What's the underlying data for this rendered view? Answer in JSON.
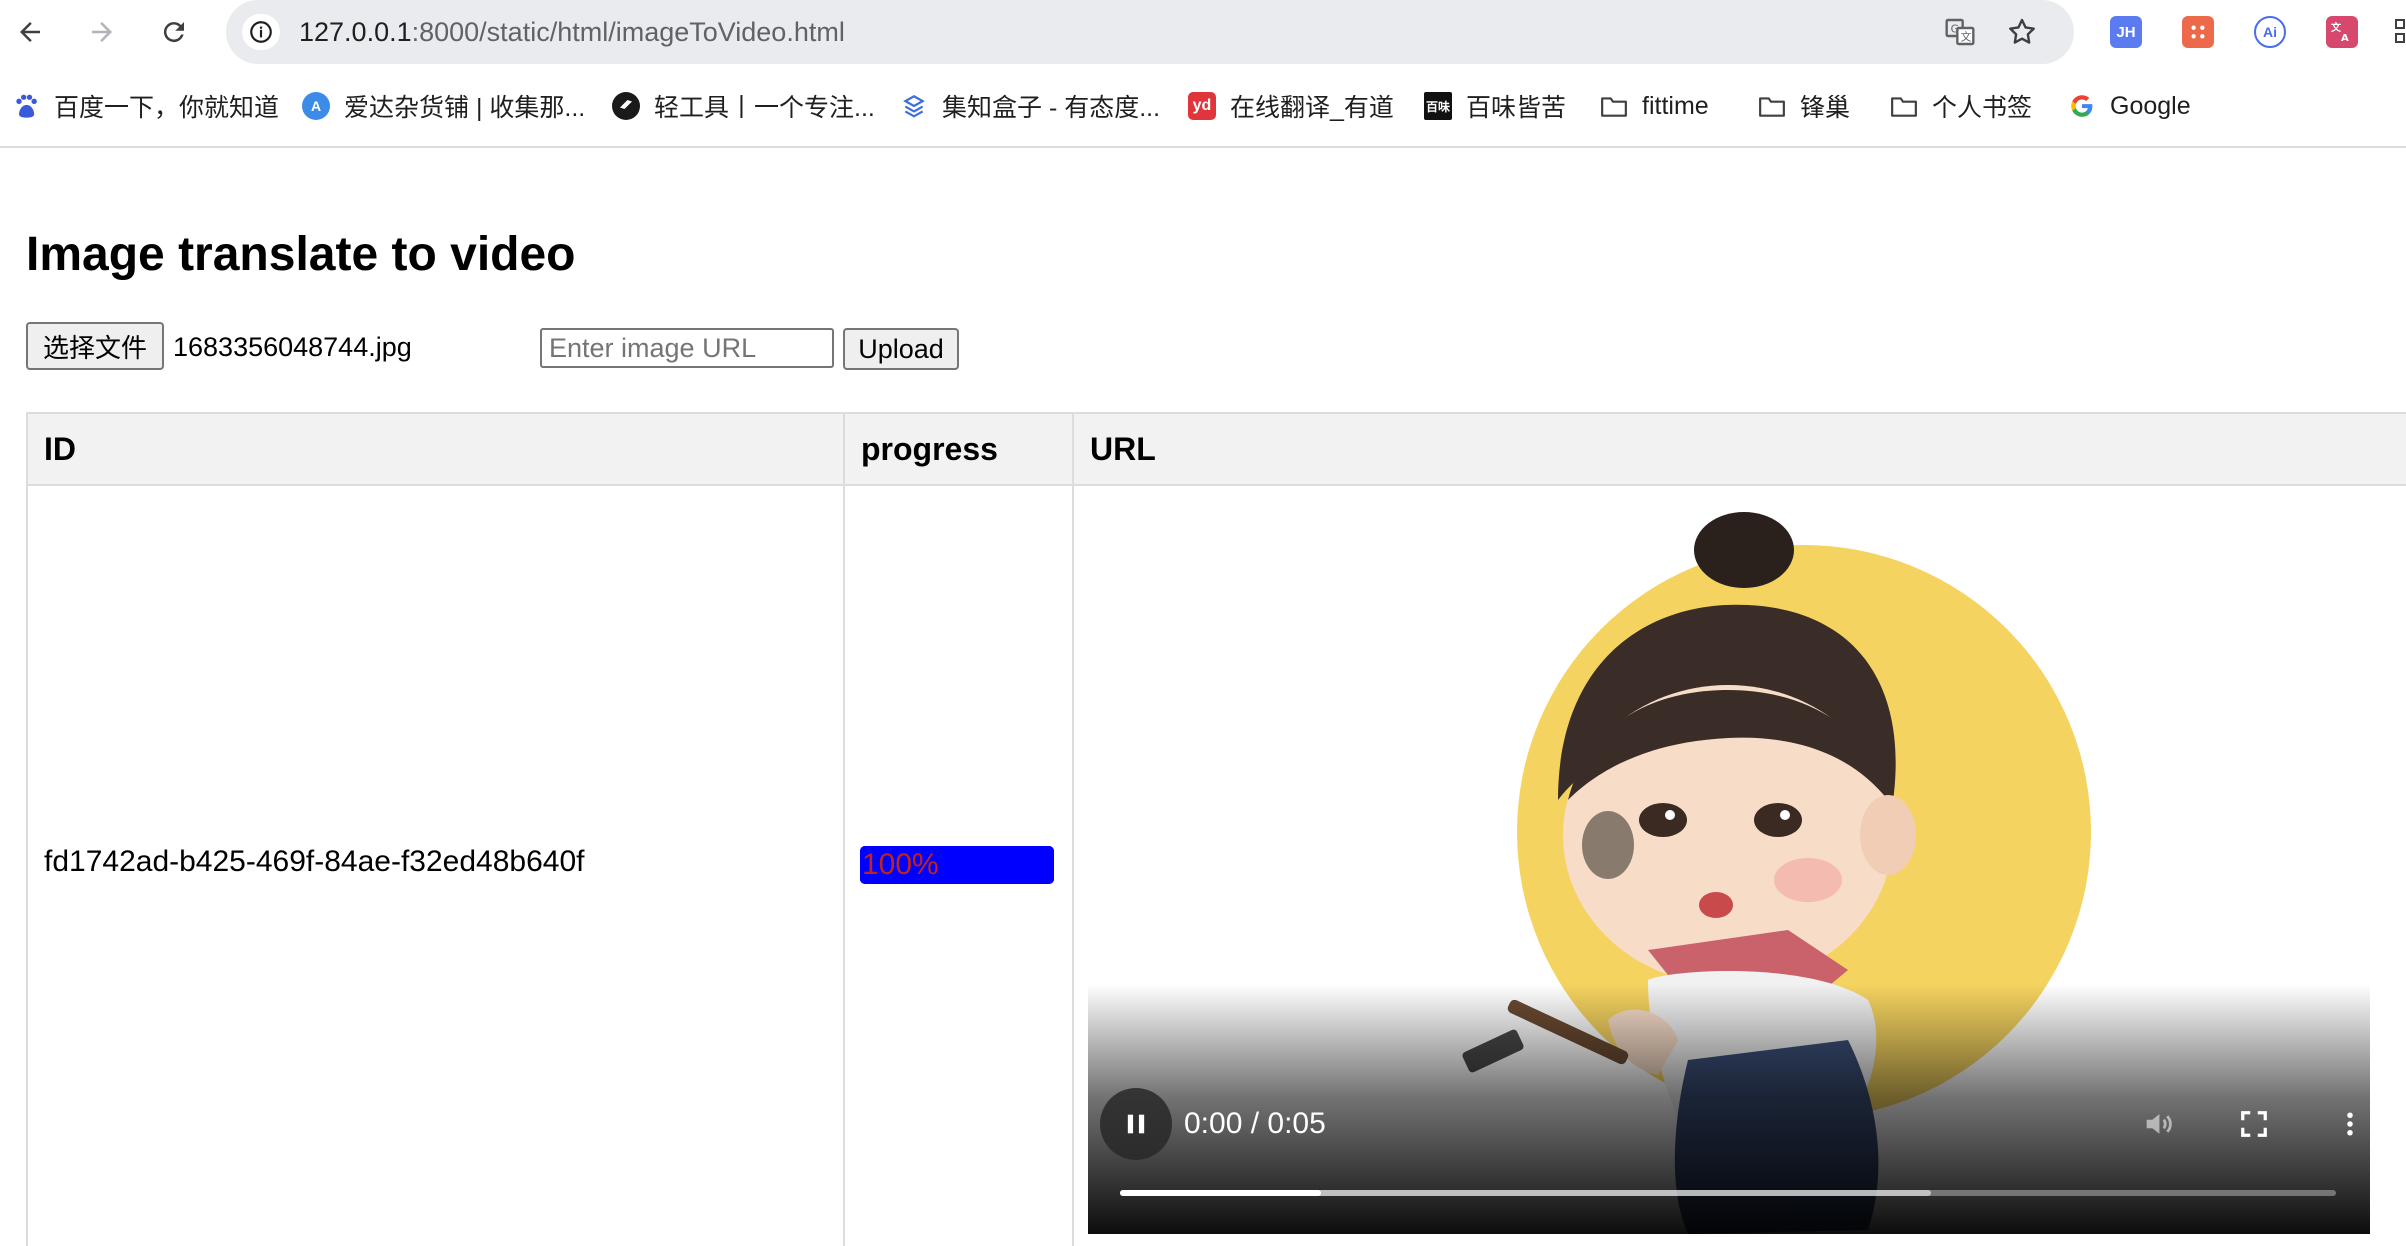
{
  "browser": {
    "nav": {
      "back_icon": "arrow-left-icon",
      "forward_icon": "arrow-right-icon",
      "reload_icon": "reload-icon"
    },
    "address": {
      "host": "127.0.0.1",
      "path": ":8000/static/html/imageToVideo.html",
      "info_icon": "info-icon"
    },
    "omnibox_icons": [
      "translate-icon",
      "star-icon"
    ],
    "extensions": [
      {
        "label": "JH",
        "color": "#5b7bf0"
      },
      {
        "label": "",
        "color": "#ec6a4a"
      },
      {
        "label": "Ai",
        "color": "#4a6cf0"
      },
      {
        "label": "",
        "color": "#d6486e"
      }
    ]
  },
  "bookmarks": [
    {
      "label": "百度一下，你就知道",
      "icon": "baidu-paw-icon"
    },
    {
      "label": "爱达杂货铺 | 收集那...",
      "icon": "letter-a-icon"
    },
    {
      "label": "轻工具丨一个专注...",
      "icon": "light-tool-icon"
    },
    {
      "label": "集知盒子 - 有态度...",
      "icon": "box-icon"
    },
    {
      "label": "在线翻译_有道",
      "icon": "youdao-icon",
      "badge": "yd"
    },
    {
      "label": "百味皆苦",
      "icon": "baiwei-icon",
      "badge": "百味"
    },
    {
      "label": "fittime",
      "icon": "folder-icon"
    },
    {
      "label": "锋巢",
      "icon": "folder-icon"
    },
    {
      "label": "个人书签",
      "icon": "folder-icon"
    },
    {
      "label": "Google",
      "icon": "google-icon"
    }
  ],
  "page": {
    "title": "Image translate to video",
    "file_button": "选择文件",
    "file_name": "1683356048744.jpg",
    "url_placeholder": "Enter image URL",
    "upload_button": "Upload"
  },
  "table": {
    "headers": [
      "ID",
      "progress",
      "URL"
    ],
    "rows": [
      {
        "id": "fd1742ad-b425-469f-84ae-f32ed48b640f",
        "progress_label": "100%",
        "progress_value": 100
      }
    ]
  },
  "video": {
    "time": "0:00 / 0:05",
    "played_fraction": 0.165,
    "buffered_fraction": 0.667,
    "controls": [
      "pause-icon",
      "mute-icon",
      "fullscreen-icon",
      "more-vert-icon"
    ]
  },
  "colors": {
    "progress_bar": "#0000ff",
    "progress_text": "#c0221c",
    "circle": "#f5d360"
  }
}
